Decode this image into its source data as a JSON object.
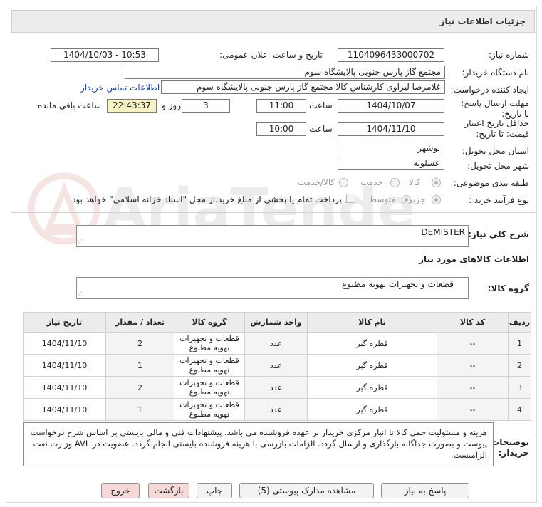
{
  "header": {
    "title": "جزئیات اطلاعات نیاز"
  },
  "form": {
    "need_number": {
      "label": "شماره نیاز:",
      "value": "1104096433000702"
    },
    "announce_datetime": {
      "label": "تاریخ و ساعت اعلان عمومی:",
      "value": "1404/10/03 - 10:53"
    },
    "buyer_org": {
      "label": "نام دستگاه خریدار:",
      "value": "مجتمع گاز پارس جنوبی  پالایشگاه سوم"
    },
    "requester": {
      "label": "ایجاد کننده درخواست:",
      "value": "غلامرضا لیراوی کارشناس کالا مجتمع گاز پارس جنوبی  پالایشگاه سوم",
      "contact_link": "اطلاعات تماس خریدار"
    },
    "reply_deadline": {
      "label": "مهلت ارسال پاسخ: تا تاریخ:",
      "date": "1404/10/07",
      "time_label": "ساعت",
      "time": "11:00",
      "days": "3",
      "days_label": "روز و",
      "remaining": "22:43:37",
      "remaining_label": "ساعت باقی مانده"
    },
    "price_validity": {
      "label": "حداقل تاریخ اعتبار قیمت: تا تاریخ:",
      "date": "1404/11/10",
      "time_label": "ساعت",
      "time": "10:00"
    },
    "province": {
      "label": "استان محل تحویل:",
      "value": "بوشهر"
    },
    "city": {
      "label": "شهر محل تحویل:",
      "value": "عسلویه"
    },
    "category": {
      "label": "طبقه بندی موضوعی:",
      "options": [
        "کالا",
        "خدمت",
        "کالا/خدمت"
      ],
      "selected": "کالا"
    },
    "purchase_type": {
      "label": "نوع فرآیند خرید :",
      "options": [
        "جزیی",
        "متوسط"
      ],
      "selected": "جزیی",
      "payment_note": "پرداخت تمام یا بخشی از مبلغ خرید،از محل \"اسناد خزانه اسلامی\" خواهد بود."
    }
  },
  "summary": {
    "label": "شرح کلی نیاز:",
    "value": "DEMISTER"
  },
  "goods_section": {
    "title": "اطلاعات کالاهای مورد نیاز",
    "group_label": "گروه کالا:",
    "group_value": "قطعات و تجهیزات تهویه مطبوع"
  },
  "table": {
    "headers": [
      "ردیف",
      "کد کالا",
      "نام کالا",
      "واحد شمارش",
      "گروه کالا",
      "تعداد / مقدار",
      "تاریخ نیاز"
    ],
    "rows": [
      {
        "row": "1",
        "code": "--",
        "name": "قطره گیر",
        "unit": "عدد",
        "group": "قطعات و تجهیزات تهویه مطبوع",
        "qty": "2",
        "date": "1404/11/10"
      },
      {
        "row": "2",
        "code": "--",
        "name": "قطره گیر",
        "unit": "عدد",
        "group": "قطعات و تجهیزات تهویه مطبوع",
        "qty": "1",
        "date": "1404/11/10"
      },
      {
        "row": "3",
        "code": "--",
        "name": "قطره گیر",
        "unit": "عدد",
        "group": "قطعات و تجهیزات تهویه مطبوع",
        "qty": "2",
        "date": "1404/11/10"
      },
      {
        "row": "4",
        "code": "--",
        "name": "قطره گیر",
        "unit": "عدد",
        "group": "قطعات و تجهیزات تهویه مطبوع",
        "qty": "1",
        "date": "1404/11/10"
      }
    ]
  },
  "buyer_notes": {
    "label": "توضیحات خریدار:",
    "value": "هزینه و مسئولیت حمل کالا تا انبار مرکزی خریدار بر عهده فروشنده می باشد. پیشنهادات فنی و مالی بایستی بر اساس شرح درخواست پیوست و بصورت جداگانه بارگذاری و ارسال گردد. الزامات بازرسی با هزینه فروشنده بایستی انجام گردد. عضویت در AVL وزارت نفت الزامیست."
  },
  "buttons": {
    "reply": "پاسخ به نیاز",
    "docs": "مشاهده مدارک پیوستی (5)",
    "print": "چاپ",
    "back": "بازگشت",
    "exit": "خروج"
  },
  "watermark": {
    "text": "AriaTender.net"
  },
  "colors": {
    "link": "#1a3fb5",
    "header_bg": "#ececec",
    "remaining_bg": "#f7f3c6",
    "back_exit_bg": "#f7d8d8"
  }
}
